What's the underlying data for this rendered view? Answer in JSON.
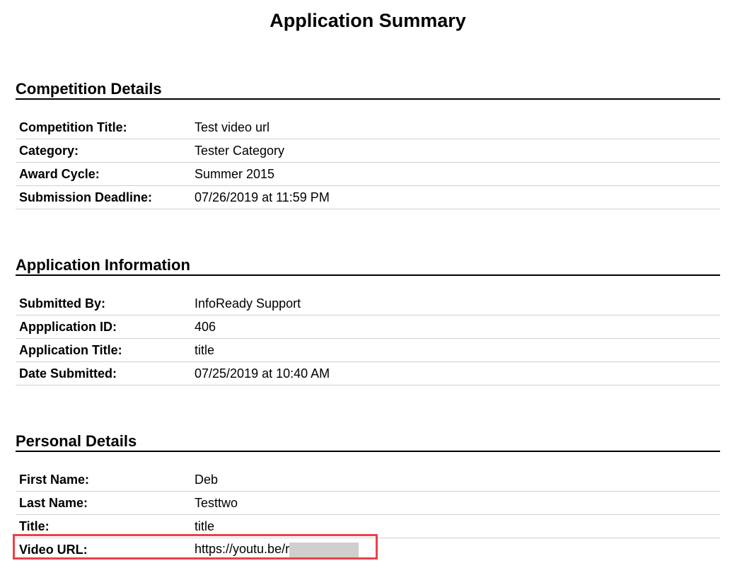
{
  "page_title": "Application Summary",
  "sections": [
    {
      "title": "Competition Details",
      "rows": [
        {
          "label": "Competition Title:",
          "value": "Test video url"
        },
        {
          "label": "Category:",
          "value": "Tester Category"
        },
        {
          "label": "Award Cycle:",
          "value": "Summer 2015"
        },
        {
          "label": "Submission Deadline:",
          "value": "07/26/2019 at 11:59 PM"
        }
      ]
    },
    {
      "title": "Application Information",
      "rows": [
        {
          "label": "Submitted By:",
          "value": "InfoReady Support"
        },
        {
          "label": "Appplication ID:",
          "value": "406"
        },
        {
          "label": "Application Title:",
          "value": "title"
        },
        {
          "label": "Date Submitted:",
          "value": "07/25/2019 at 10:40 AM"
        }
      ]
    },
    {
      "title": "Personal Details",
      "rows": [
        {
          "label": "First Name:",
          "value": "Deb"
        },
        {
          "label": "Last Name:",
          "value": "Testtwo"
        },
        {
          "label": "Title:",
          "value": "title"
        },
        {
          "label": "Video URL:",
          "value": "https://youtu.be/r"
        }
      ]
    }
  ],
  "colors": {
    "highlight_border": "#e8424a",
    "redaction": "#cfcfcf",
    "row_divider": "#d0d0d0"
  }
}
